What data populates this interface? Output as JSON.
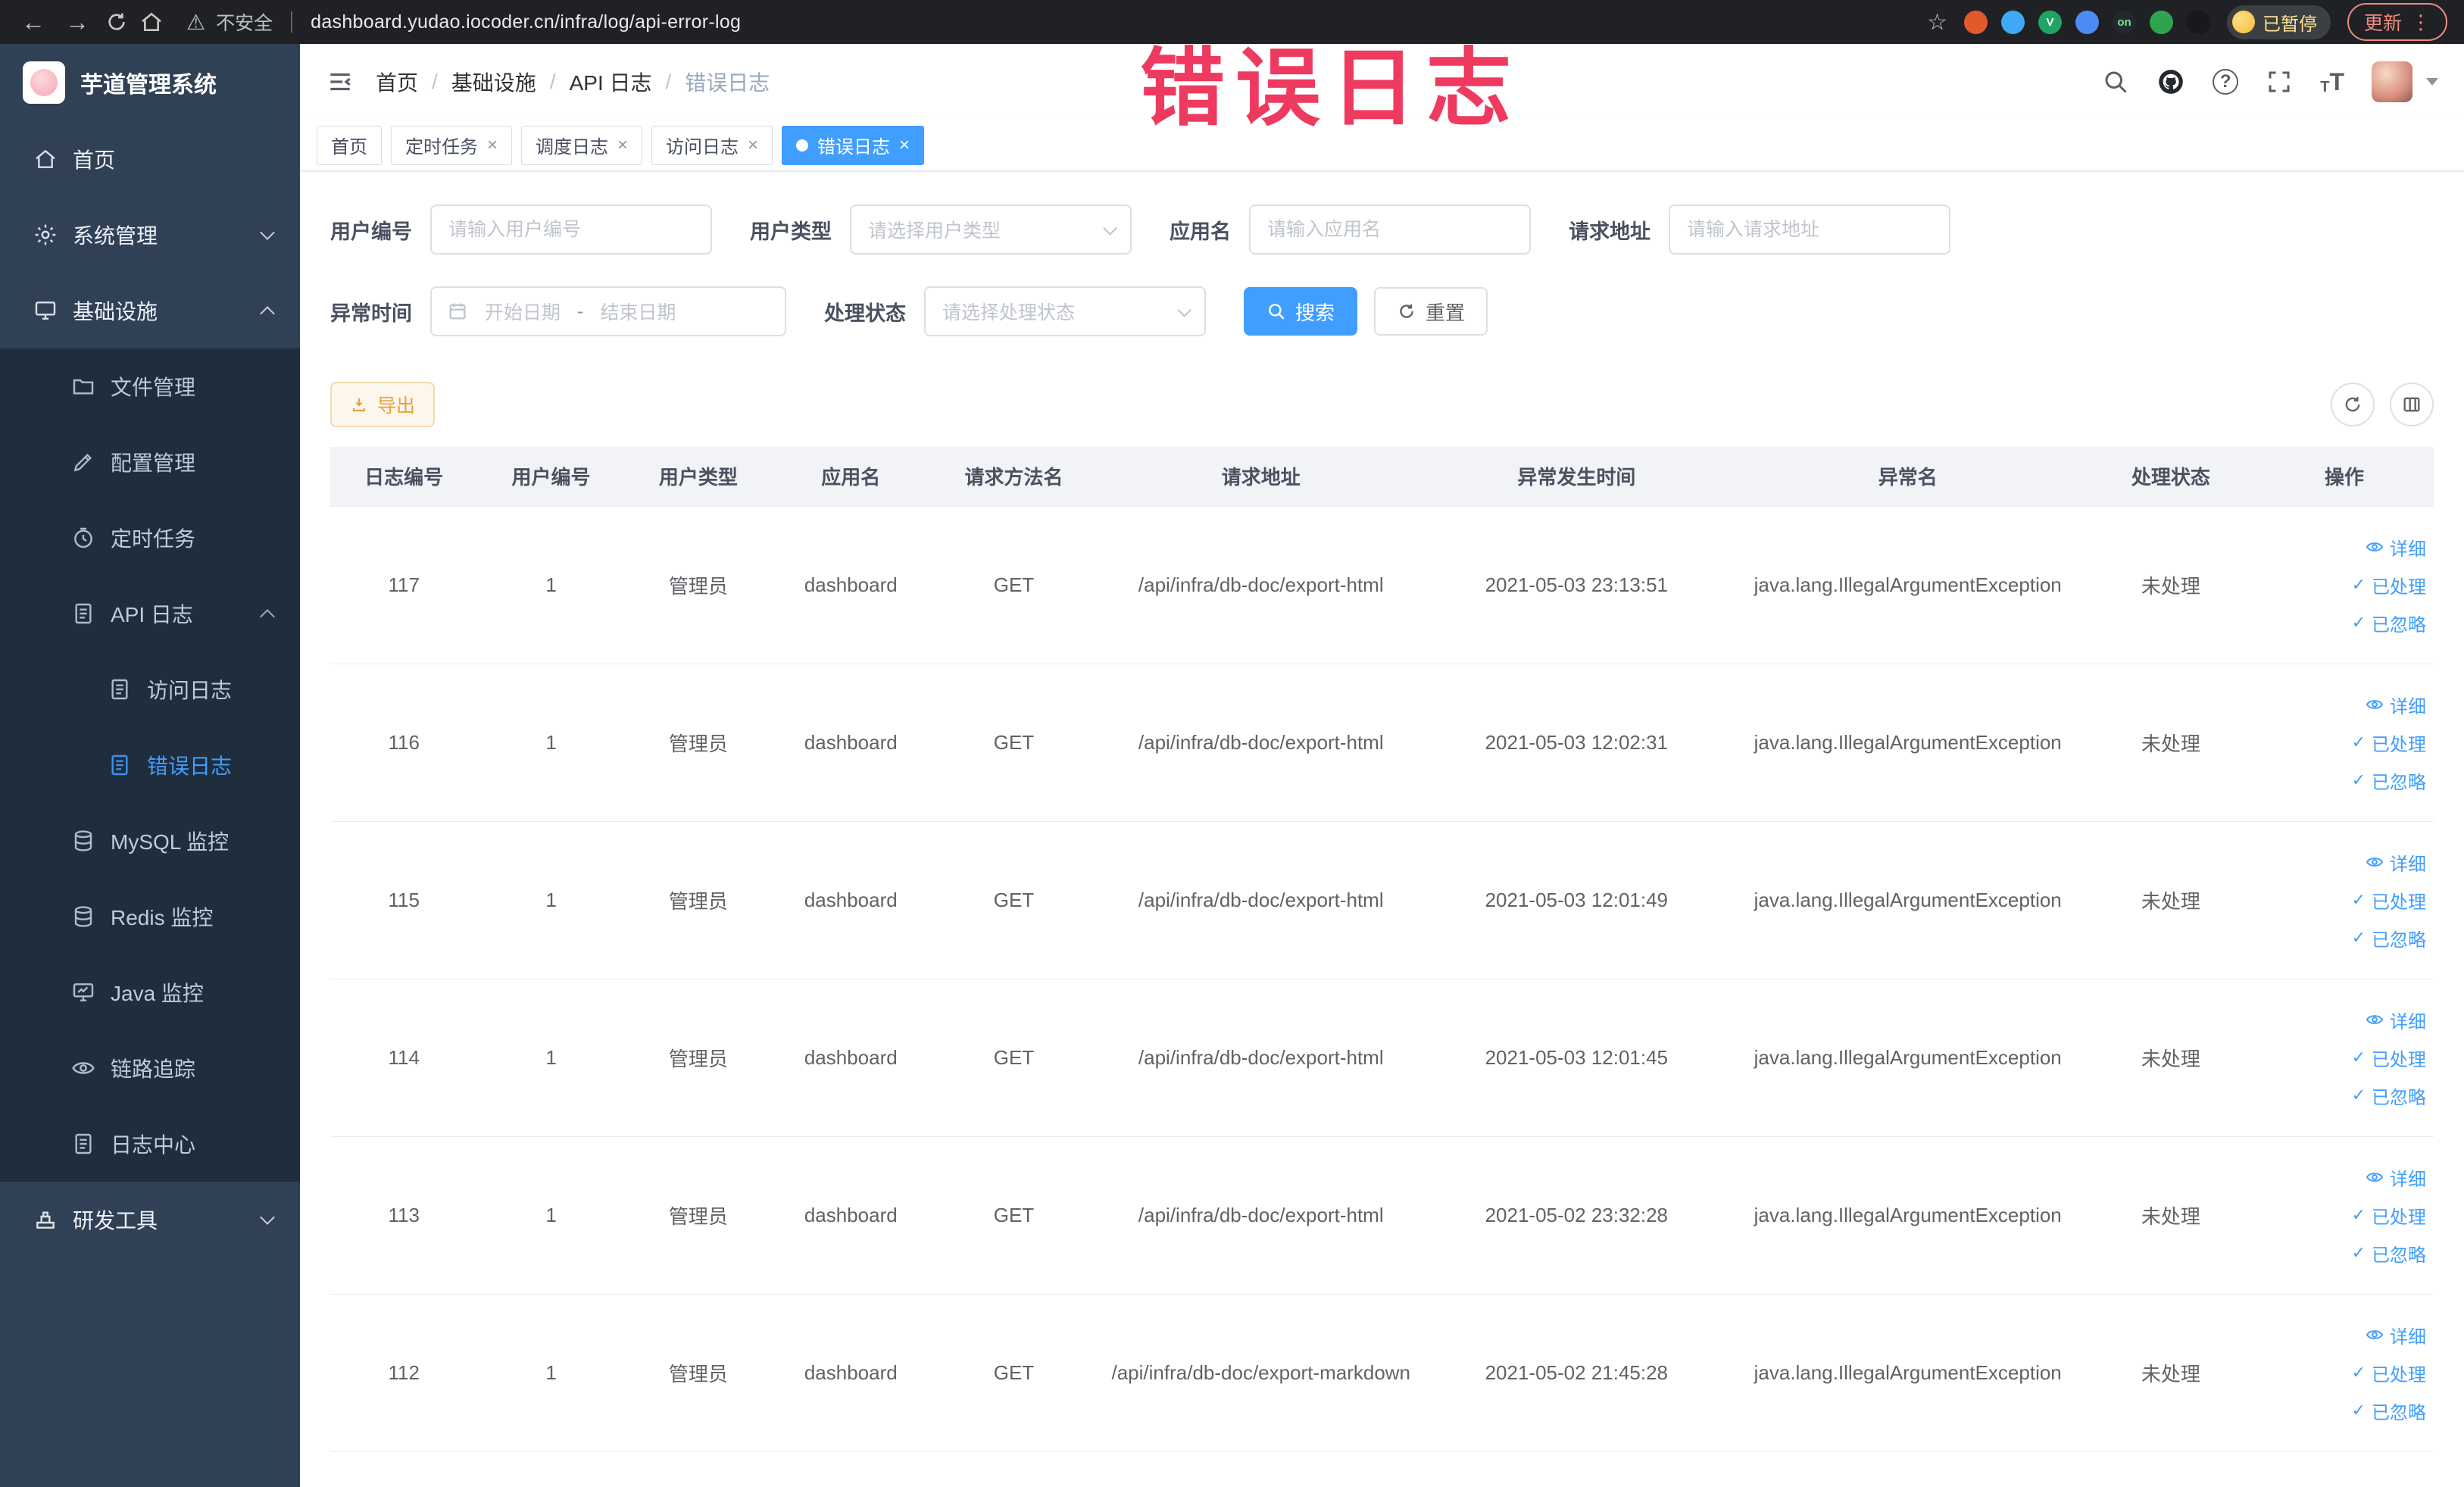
{
  "watermark": "错误日志",
  "colors": {
    "accent": "#409eff",
    "sidebar_bg": "#304156",
    "submenu_bg": "#1f2d3d",
    "warning": "#e6a23c",
    "watermark_red": "#ee3a5f"
  },
  "browser": {
    "security_label": "不安全",
    "url": "dashboard.yudao.iocoder.cn/infra/log/api-error-log",
    "paused_badge": "已暂停",
    "update_label": "更新",
    "extensions": [
      {
        "color": "#e25a2b",
        "glyph": ""
      },
      {
        "color": "#3fa9f5",
        "glyph": ""
      },
      {
        "color": "#1fa463",
        "glyph": "V"
      },
      {
        "color": "#4c8bf5",
        "glyph": ""
      },
      {
        "color": "#23272e",
        "glyph": "on"
      },
      {
        "color": "#2ea44f",
        "glyph": ""
      },
      {
        "color": "#17191d",
        "glyph": ""
      }
    ]
  },
  "sidebar": {
    "logo_title": "芋道管理系统",
    "menu": [
      {
        "key": "home",
        "label": "首页",
        "icon": "home",
        "level": 1
      },
      {
        "key": "system",
        "label": "系统管理",
        "icon": "gear",
        "level": 1,
        "arrow": "down"
      },
      {
        "key": "infra",
        "label": "基础设施",
        "icon": "infra",
        "level": 1,
        "arrow": "up"
      },
      {
        "key": "file",
        "label": "文件管理",
        "icon": "file",
        "level": 2
      },
      {
        "key": "config",
        "label": "配置管理",
        "icon": "config",
        "level": 2
      },
      {
        "key": "job",
        "label": "定时任务",
        "icon": "timer",
        "level": 2
      },
      {
        "key": "api-log",
        "label": "API 日志",
        "icon": "doc",
        "level": 2,
        "arrow": "up"
      },
      {
        "key": "access-log",
        "label": "访问日志",
        "icon": "doc",
        "level": 3
      },
      {
        "key": "error-log",
        "label": "错误日志",
        "icon": "doc",
        "level": 3,
        "active": true
      },
      {
        "key": "mysql",
        "label": "MySQL 监控",
        "icon": "db",
        "level": 2
      },
      {
        "key": "redis",
        "label": "Redis 监控",
        "icon": "db",
        "level": 2
      },
      {
        "key": "java",
        "label": "Java 监控",
        "icon": "monitor",
        "level": 2
      },
      {
        "key": "trace",
        "label": "链路追踪",
        "icon": "eye",
        "level": 2
      },
      {
        "key": "log-center",
        "label": "日志中心",
        "icon": "doc",
        "level": 2
      },
      {
        "key": "dev-tools",
        "label": "研发工具",
        "icon": "tools",
        "level": 1,
        "arrow": "down"
      }
    ]
  },
  "breadcrumb": [
    "首页",
    "基础设施",
    "API 日志",
    "错误日志"
  ],
  "tabs": [
    {
      "key": "home",
      "label": "首页",
      "closable": false,
      "active": false
    },
    {
      "key": "job",
      "label": "定时任务",
      "closable": true,
      "active": false
    },
    {
      "key": "job-log",
      "label": "调度日志",
      "closable": true,
      "active": false
    },
    {
      "key": "access-log",
      "label": "访问日志",
      "closable": true,
      "active": false
    },
    {
      "key": "error-log",
      "label": "错误日志",
      "closable": true,
      "active": true
    }
  ],
  "filters": {
    "user_id": {
      "label": "用户编号",
      "placeholder": "请输入用户编号"
    },
    "user_type": {
      "label": "用户类型",
      "placeholder": "请选择用户类型"
    },
    "app_name": {
      "label": "应用名",
      "placeholder": "请输入应用名"
    },
    "request_url": {
      "label": "请求地址",
      "placeholder": "请输入请求地址"
    },
    "exception_time": {
      "label": "异常时间",
      "start_placeholder": "开始日期",
      "separator": "-",
      "end_placeholder": "结束日期"
    },
    "process_status": {
      "label": "处理状态",
      "placeholder": "请选择处理状态"
    },
    "search_label": "搜索",
    "reset_label": "重置"
  },
  "toolbar": {
    "export_label": "导出"
  },
  "table": {
    "columns": [
      "日志编号",
      "用户编号",
      "用户类型",
      "应用名",
      "请求方法名",
      "请求地址",
      "异常发生时间",
      "异常名",
      "处理状态",
      "操作"
    ],
    "action_labels": {
      "detail": "详细",
      "processed": "已处理",
      "ignored": "已忽略"
    },
    "rows": [
      {
        "id": "117",
        "user_id": "1",
        "user_type": "管理员",
        "app": "dashboard",
        "method": "GET",
        "url": "/api/infra/db-doc/export-html",
        "time": "2021-05-03 23:13:51",
        "exception": "java.lang.IllegalArgumentException",
        "status": "未处理"
      },
      {
        "id": "116",
        "user_id": "1",
        "user_type": "管理员",
        "app": "dashboard",
        "method": "GET",
        "url": "/api/infra/db-doc/export-html",
        "time": "2021-05-03 12:02:31",
        "exception": "java.lang.IllegalArgumentException",
        "status": "未处理"
      },
      {
        "id": "115",
        "user_id": "1",
        "user_type": "管理员",
        "app": "dashboard",
        "method": "GET",
        "url": "/api/infra/db-doc/export-html",
        "time": "2021-05-03 12:01:49",
        "exception": "java.lang.IllegalArgumentException",
        "status": "未处理"
      },
      {
        "id": "114",
        "user_id": "1",
        "user_type": "管理员",
        "app": "dashboard",
        "method": "GET",
        "url": "/api/infra/db-doc/export-html",
        "time": "2021-05-03 12:01:45",
        "exception": "java.lang.IllegalArgumentException",
        "status": "未处理"
      },
      {
        "id": "113",
        "user_id": "1",
        "user_type": "管理员",
        "app": "dashboard",
        "method": "GET",
        "url": "/api/infra/db-doc/export-html",
        "time": "2021-05-02 23:32:28",
        "exception": "java.lang.IllegalArgumentException",
        "status": "未处理"
      },
      {
        "id": "112",
        "user_id": "1",
        "user_type": "管理员",
        "app": "dashboard",
        "method": "GET",
        "url": "/api/infra/db-doc/export-markdown",
        "time": "2021-05-02 21:45:28",
        "exception": "java.lang.IllegalArgumentException",
        "status": "未处理"
      }
    ]
  }
}
